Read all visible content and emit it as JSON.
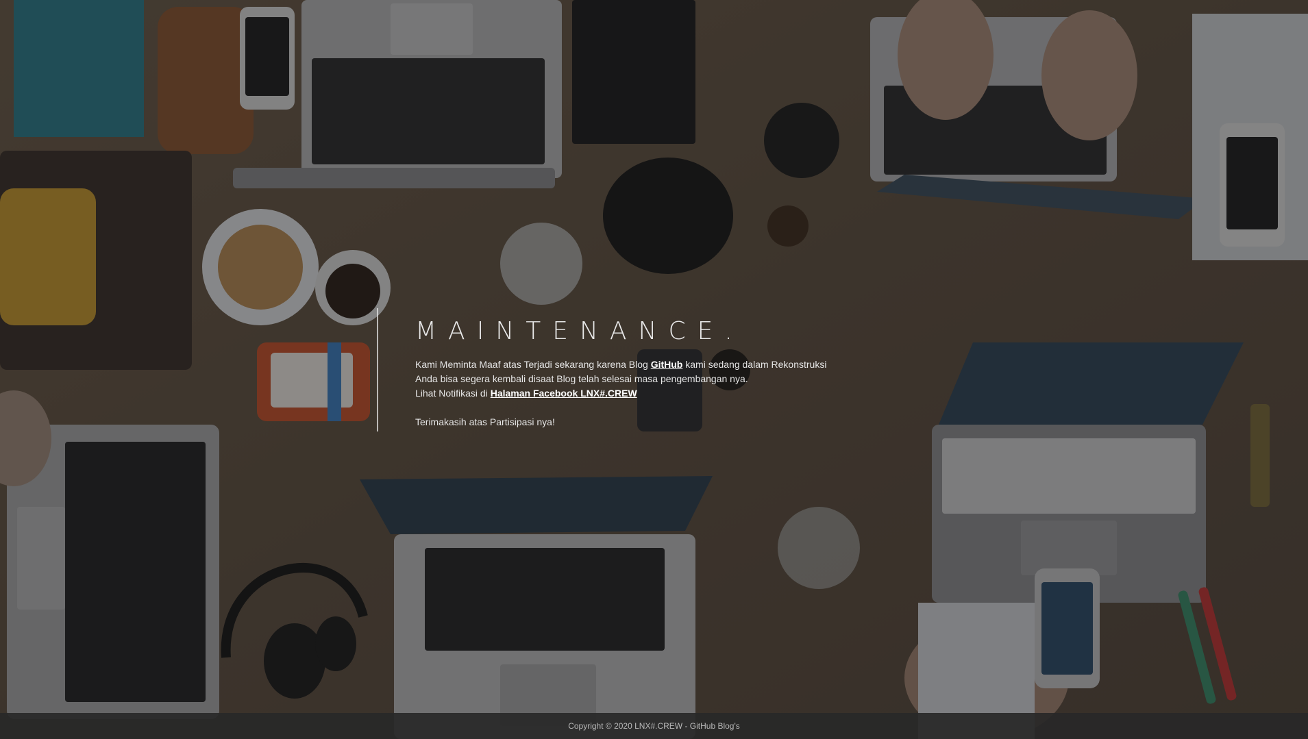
{
  "page": {
    "title": "MAINTENANCE.",
    "line1_pre": "Kami Meminta Maaf atas Terjadi sekarang karena Blog ",
    "line1_link": "GitHub",
    "line1_post": " kami sedang dalam Rekonstruksi",
    "line2": "Anda bisa segera kembali disaat Blog telah selesai masa pengembangan nya.",
    "line3_pre": "Lihat Notifikasi di ",
    "line3_link": "Halaman Facebook LNX#.CREW",
    "thanks": "Terimakasih atas Partisipasi nya!"
  },
  "footer": {
    "copyright": "Copyright © 2020 LNX#.CREW - GitHub Blog's"
  },
  "colors": {
    "overlay": "#141414",
    "text": "#e6e6e6",
    "footer_bg": "#282828",
    "desk": "#5a4a3a"
  }
}
